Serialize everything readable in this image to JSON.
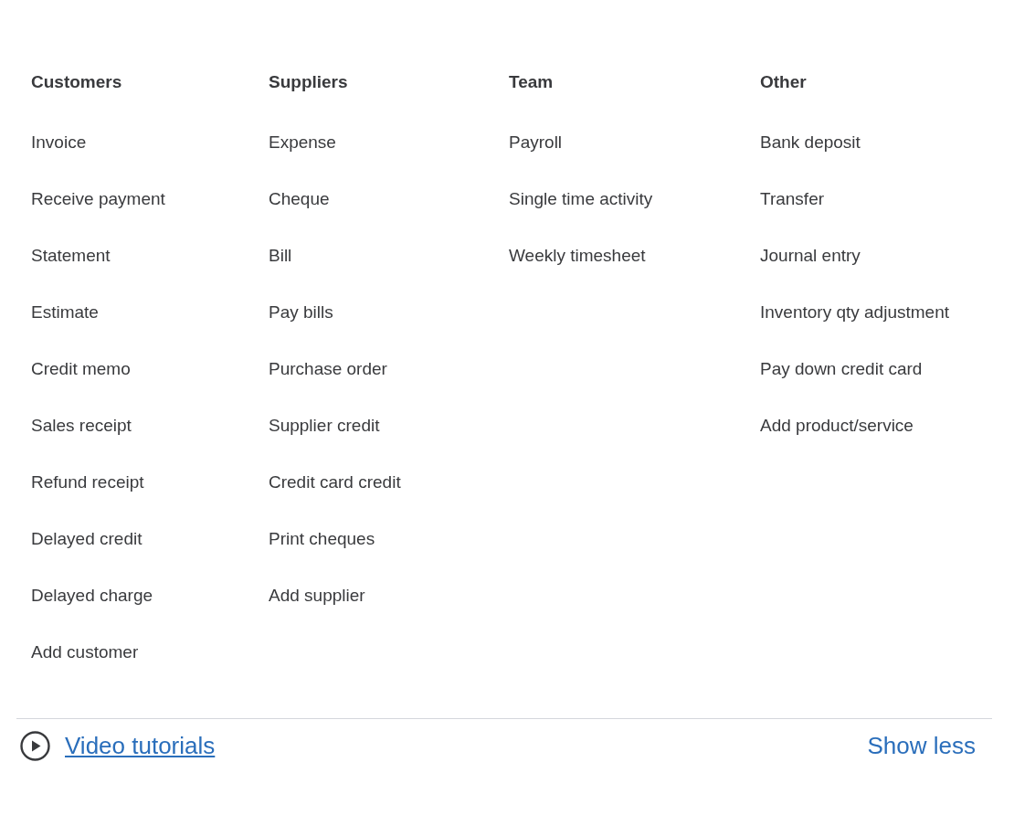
{
  "columns": [
    {
      "heading": "Customers",
      "items": [
        "Invoice",
        "Receive payment",
        "Statement",
        "Estimate",
        "Credit memo",
        "Sales receipt",
        "Refund receipt",
        "Delayed credit",
        "Delayed charge",
        "Add customer"
      ]
    },
    {
      "heading": "Suppliers",
      "items": [
        "Expense",
        "Cheque",
        "Bill",
        "Pay bills",
        "Purchase order",
        "Supplier credit",
        "Credit card credit",
        "Print cheques",
        "Add supplier"
      ]
    },
    {
      "heading": "Team",
      "items": [
        "Payroll",
        "Single time activity",
        "Weekly timesheet"
      ]
    },
    {
      "heading": "Other",
      "items": [
        "Bank deposit",
        "Transfer",
        "Journal entry",
        "Inventory qty adjustment",
        "Pay down credit card",
        "Add product/service"
      ]
    }
  ],
  "footer": {
    "link": "Video tutorials",
    "toggle": "Show less"
  }
}
